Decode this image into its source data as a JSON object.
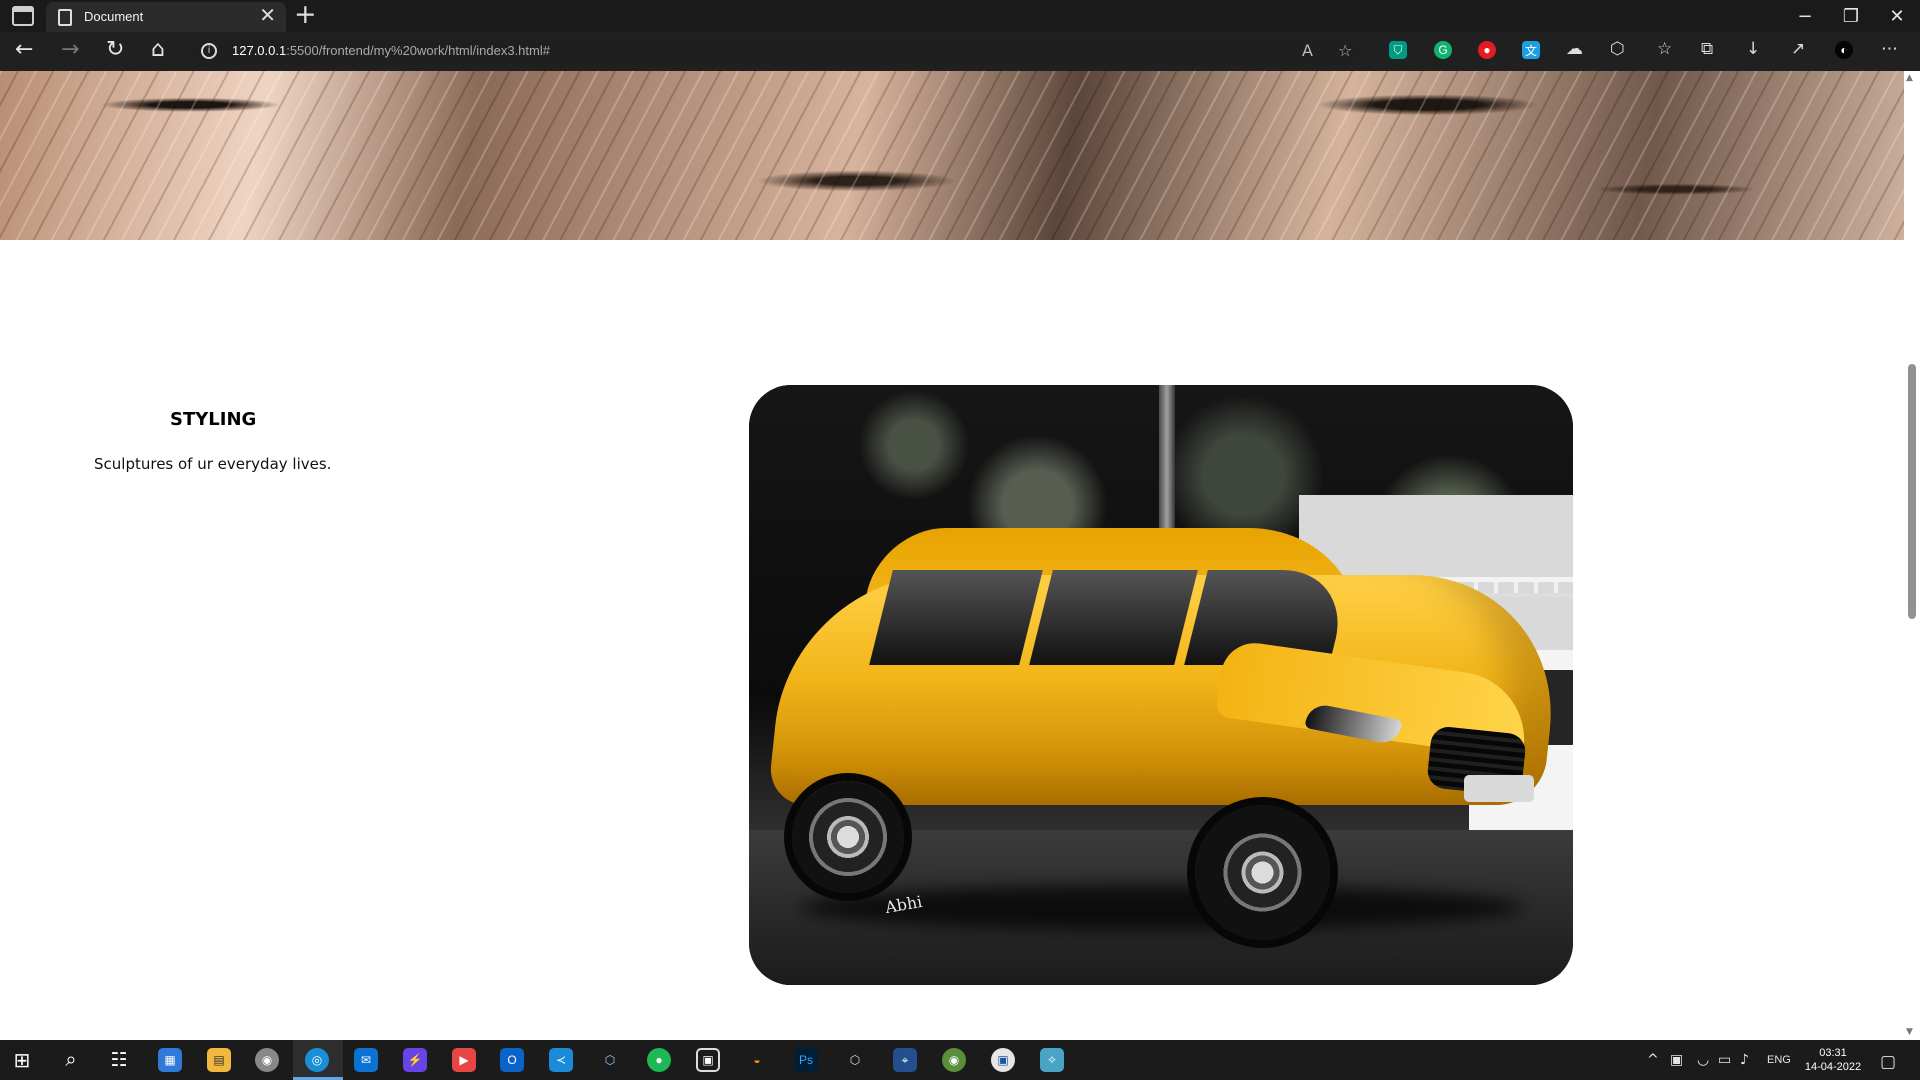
{
  "browser": {
    "tab_title": "Document",
    "tab_close": "✕",
    "new_tab": "+",
    "window_controls": {
      "minimize": "−",
      "restore": "❐",
      "close": "✕"
    },
    "nav": {
      "back": "←",
      "forward": "→",
      "refresh": "↻",
      "home": "⌂"
    },
    "address": {
      "info": "i",
      "host": "127.0.0.1",
      "path": ":5500/frontend/my%20work/html/index3.html#"
    },
    "toolbar_icons": {
      "read_aloud": "A",
      "favorite": "☆",
      "shield": "⛉",
      "grammarly": "G",
      "record": "●",
      "translate": "文",
      "cloud": "☁",
      "extensions": "⬡",
      "favorites": "☆",
      "collections": "⧉",
      "download": "↓",
      "share": "↗",
      "profile": "◐",
      "menu": "⋯"
    }
  },
  "page": {
    "section_title": "STYLING",
    "section_text": "Sculptures of ur everyday lives.",
    "signature": "Abhi"
  },
  "scrollbar": {
    "up": "▲",
    "down": "▼"
  },
  "taskbar": {
    "start": "⊞",
    "search": "⌕",
    "task_view": "☷",
    "apps": [
      "▦",
      "▤",
      "◉",
      "◎",
      "✉",
      "⚡",
      "▶",
      "O",
      "≺",
      "⬡",
      "●",
      "▣",
      "◒",
      "Ps",
      "⬡",
      "⌖",
      "◉",
      "▣",
      "✧"
    ],
    "tray": {
      "chevron": "^",
      "network": "▣",
      "wifi": "◡",
      "battery": "▭",
      "volume": "♪",
      "language": "ENG",
      "notifications": "▢"
    },
    "time": "03:31",
    "date": "14-04-2022"
  },
  "colors": {
    "browser_dark": "#202020",
    "address_bar": "#1f1f1f",
    "car_yellow": "#f2b518",
    "taskbar": "#1b1b1b",
    "accent_blue": "#61a6e8"
  }
}
